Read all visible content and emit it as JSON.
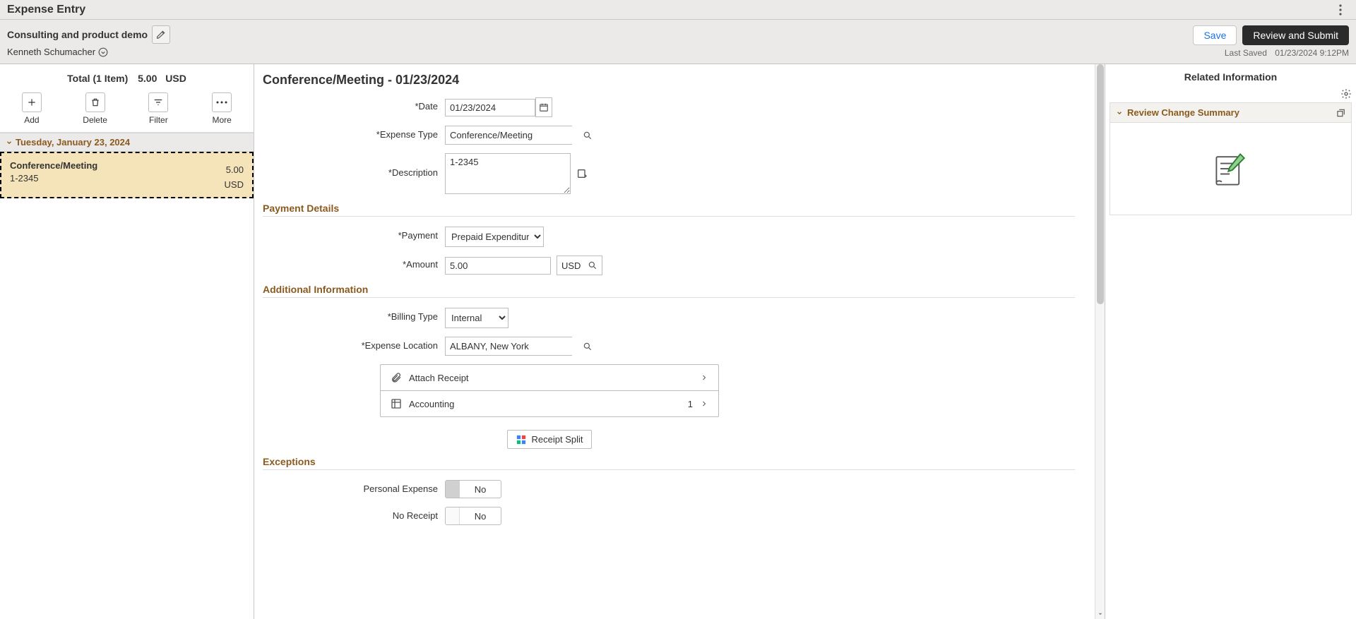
{
  "topbar": {
    "title": "Expense Entry"
  },
  "subheader": {
    "report_title": "Consulting and product demo",
    "user_name": "Kenneth Schumacher",
    "save_label": "Save",
    "submit_label": "Review and Submit",
    "last_saved_label": "Last Saved",
    "last_saved_value": "01/23/2024  9:12PM"
  },
  "left": {
    "total_label": "Total (1 Item)",
    "total_amount": "5.00",
    "total_currency": "USD",
    "tools": {
      "add": "Add",
      "delete": "Delete",
      "filter": "Filter",
      "more": "More"
    },
    "group_date": "Tuesday, January 23, 2024",
    "item": {
      "type": "Conference/Meeting",
      "desc": "1-2345",
      "amount": "5.00",
      "currency": "USD"
    }
  },
  "form": {
    "title": "Conference/Meeting - 01/23/2024",
    "labels": {
      "date": "*Date",
      "expense_type": "*Expense Type",
      "description": "*Description",
      "payment": "*Payment",
      "amount": "*Amount",
      "billing_type": "*Billing Type",
      "expense_location": "*Expense Location",
      "personal_expense": "Personal Expense",
      "no_receipt": "No Receipt"
    },
    "sections": {
      "payment_details": "Payment Details",
      "additional_info": "Additional Information",
      "exceptions": "Exceptions"
    },
    "values": {
      "date": "01/23/2024",
      "expense_type": "Conference/Meeting",
      "description": "1-2345",
      "payment": "Prepaid Expenditures",
      "amount": "5.00",
      "currency": "USD",
      "billing_type": "Internal",
      "expense_location": "ALBANY, New York"
    },
    "panel_items": {
      "attach_receipt": "Attach Receipt",
      "accounting": "Accounting",
      "accounting_count": "1"
    },
    "receipt_split": "Receipt Split",
    "toggles": {
      "personal_expense": "No",
      "no_receipt": "No"
    }
  },
  "right": {
    "title": "Related Information",
    "summary_title": "Review Change Summary"
  }
}
